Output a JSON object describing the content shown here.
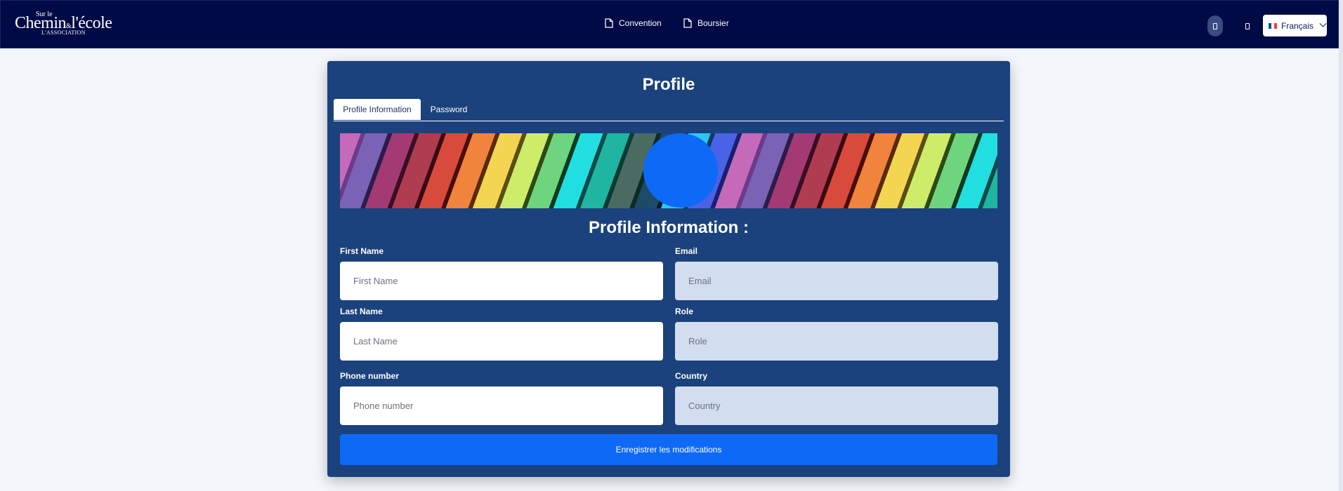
{
  "navbar": {
    "logo": {
      "small": "Sur le",
      "big": "Chemin",
      "amp": "&",
      "big2": "l'école",
      "assoc": "L'ASSOCIATION"
    },
    "links": [
      {
        "label": "Convention",
        "icon": "document-icon"
      },
      {
        "label": "Boursier",
        "icon": "document-icon"
      }
    ],
    "language": {
      "label": "Français",
      "flag_colors": [
        "#0055a4",
        "#ffffff",
        "#ef4135"
      ]
    }
  },
  "profile": {
    "title": "Profile",
    "tabs": [
      {
        "label": "Profile Information",
        "active": true
      },
      {
        "label": "Password",
        "active": false
      }
    ],
    "section_title": "Profile Information :",
    "fields": {
      "first_name": {
        "label": "First Name",
        "placeholder": "First Name",
        "value": ""
      },
      "email": {
        "label": "Email",
        "placeholder": "Email",
        "value": ""
      },
      "last_name": {
        "label": "Last Name",
        "placeholder": "Last Name",
        "value": ""
      },
      "role": {
        "label": "Role",
        "placeholder": "Role",
        "value": ""
      },
      "phone": {
        "label": "Phone number",
        "placeholder": "Phone number",
        "value": ""
      },
      "country": {
        "label": "Country",
        "placeholder": "Country",
        "value": ""
      }
    },
    "save_label": "Enregistrer les modifications"
  },
  "colors": {
    "navbar_bg": "#000a45",
    "card_bg": "#1b427c",
    "accent": "#0e6af6",
    "disabled_field": "#d2ddf0"
  }
}
